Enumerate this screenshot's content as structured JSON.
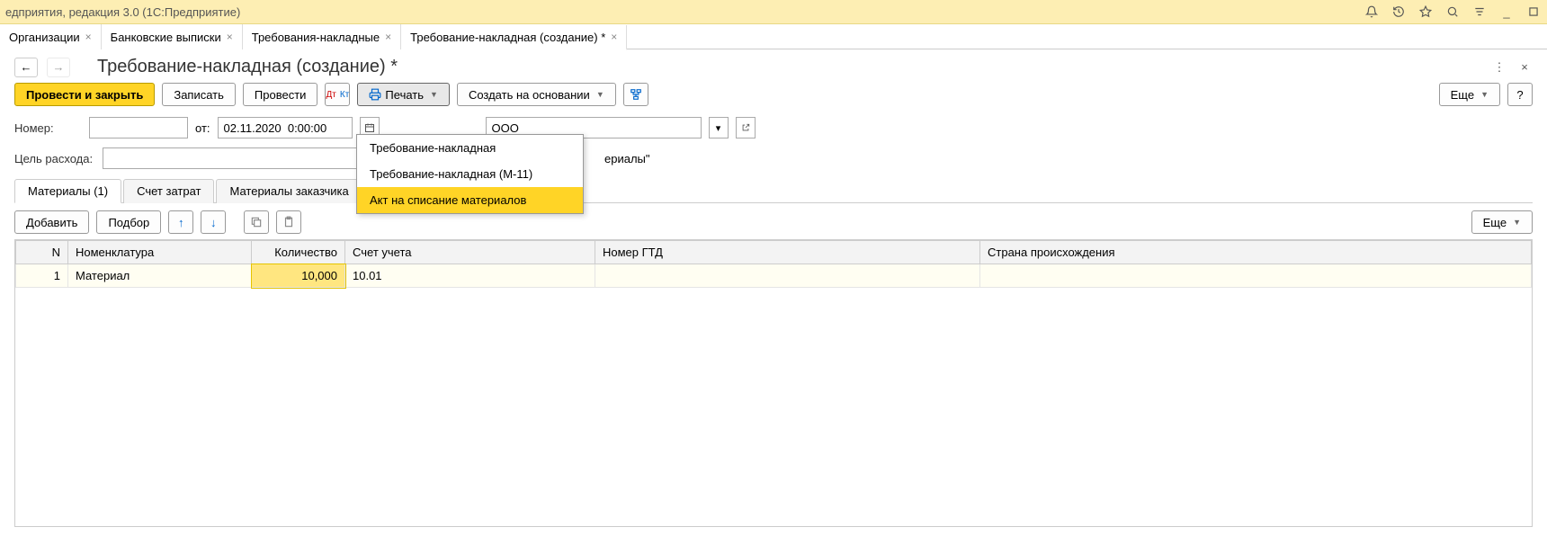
{
  "titlebar": {
    "title": "едприятия, редакция 3.0  (1С:Предприятие)"
  },
  "tabs": [
    {
      "label": "Организации"
    },
    {
      "label": "Банковские выписки"
    },
    {
      "label": "Требования-накладные"
    },
    {
      "label": "Требование-накладная (создание) *",
      "active": true
    }
  ],
  "page": {
    "title": "Требование-накладная (создание) *"
  },
  "toolbar": {
    "post_close": "Провести и закрыть",
    "save": "Записать",
    "post": "Провести",
    "print": "Печать",
    "create_based_on": "Создать на основании",
    "more": "Еще"
  },
  "print_menu": {
    "item1": "Требование-накладная",
    "item2": "Требование-накладная (М-11)",
    "item3": "Акт на списание материалов"
  },
  "form": {
    "number_label": "Номер:",
    "from_label": "от:",
    "date_value": "02.11.2020  0:00:00",
    "org_partial": "ООО",
    "goal_label": "Цель расхода:",
    "goal_partial": "ериалы\""
  },
  "subtabs": {
    "materials": "Материалы (1)",
    "cost_account": "Счет затрат",
    "customer_materials": "Материалы заказчика"
  },
  "subtoolbar": {
    "add": "Добавить",
    "pick": "Подбор",
    "more": "Еще"
  },
  "table": {
    "headers": {
      "n": "N",
      "nom": "Номенклатура",
      "qty": "Количество",
      "acc": "Счет учета",
      "gtd": "Номер ГТД",
      "country": "Страна происхождения"
    },
    "rows": [
      {
        "n": "1",
        "nom": "Материал",
        "qty": "10,000",
        "acc": "10.01",
        "gtd": "",
        "country": ""
      }
    ]
  },
  "help": "?"
}
